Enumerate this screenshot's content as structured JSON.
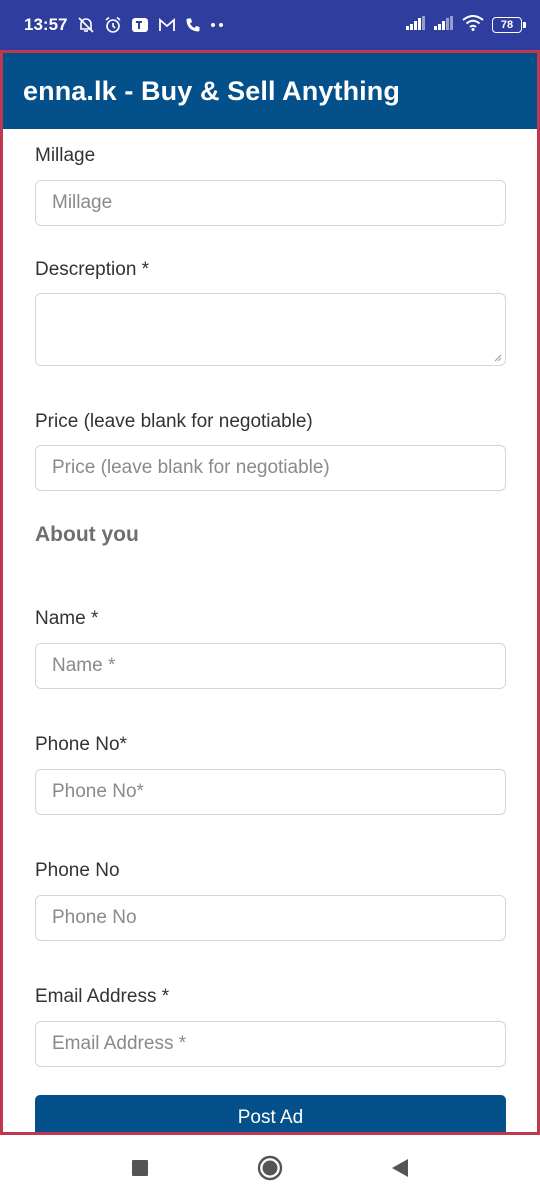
{
  "status_bar": {
    "time": "13:57",
    "battery": "78",
    "icons": [
      "bell-off-icon",
      "alarm-icon",
      "teams-icon",
      "gmail-icon",
      "phone-icon",
      "more-icon",
      "signal-icon",
      "signal-icon-2",
      "wifi-icon",
      "battery-icon"
    ]
  },
  "header": {
    "title": "enna.lk - Buy & Sell Anything",
    "background": "#03508a"
  },
  "form": {
    "millage": {
      "label": "Millage",
      "placeholder": "Millage",
      "value": ""
    },
    "description": {
      "label": "Descreption *",
      "value": ""
    },
    "price": {
      "label": "Price (leave blank for negotiable)",
      "placeholder": "Price (leave blank for negotiable)",
      "value": ""
    },
    "about_heading": "About you",
    "name": {
      "label": "Name *",
      "placeholder": "Name *",
      "value": ""
    },
    "phone1": {
      "label": "Phone No*",
      "placeholder": "Phone No*",
      "value": ""
    },
    "phone2": {
      "label": "Phone No",
      "placeholder": "Phone No",
      "value": ""
    },
    "email": {
      "label": "Email Address *",
      "placeholder": "Email Address *",
      "value": ""
    },
    "submit_label": "Post Ad"
  },
  "colors": {
    "status_bar": "#2f3d9e",
    "accent": "#03508a",
    "frame_border": "#c0384f"
  },
  "nav_bar": {
    "icons": [
      "recents-square-icon",
      "home-circle-icon",
      "back-triangle-icon"
    ]
  }
}
